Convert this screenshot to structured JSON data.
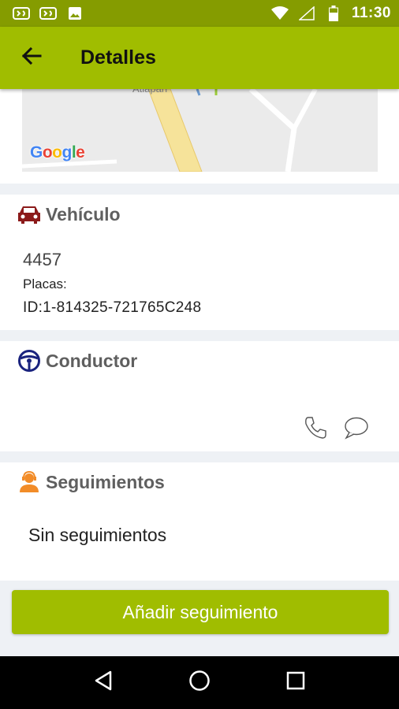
{
  "status_bar": {
    "time": "11:30",
    "left_icons": [
      "notification-icon",
      "notification-icon",
      "image-icon"
    ],
    "right_icons": [
      "wifi-icon",
      "signal-icon",
      "battery-icon"
    ]
  },
  "app_bar": {
    "title": "Detalles",
    "back_icon": "arrow-left-icon",
    "color": "#a0bd00"
  },
  "map": {
    "provider_logo": "Google",
    "place_label": "Atlapan"
  },
  "vehicle": {
    "title": "Vehículo",
    "icon": "car-icon",
    "icon_color": "#8b1a1a",
    "number": "4457",
    "plates_label": "Placas:",
    "id_text": "ID:1-814325-721765C248"
  },
  "driver": {
    "title": "Conductor",
    "icon": "steering-wheel-icon",
    "icon_color": "#1a237e",
    "actions": [
      "phone-icon",
      "chat-icon"
    ]
  },
  "tracking": {
    "title": "Seguimientos",
    "icon": "agent-icon",
    "icon_color": "#f28c28",
    "empty_text": "Sin seguimientos"
  },
  "actions": {
    "add_tracking_label": "Añadir seguimiento"
  },
  "nav_bar": {
    "buttons": [
      "back-triangle-icon",
      "home-circle-icon",
      "recents-square-icon"
    ]
  }
}
